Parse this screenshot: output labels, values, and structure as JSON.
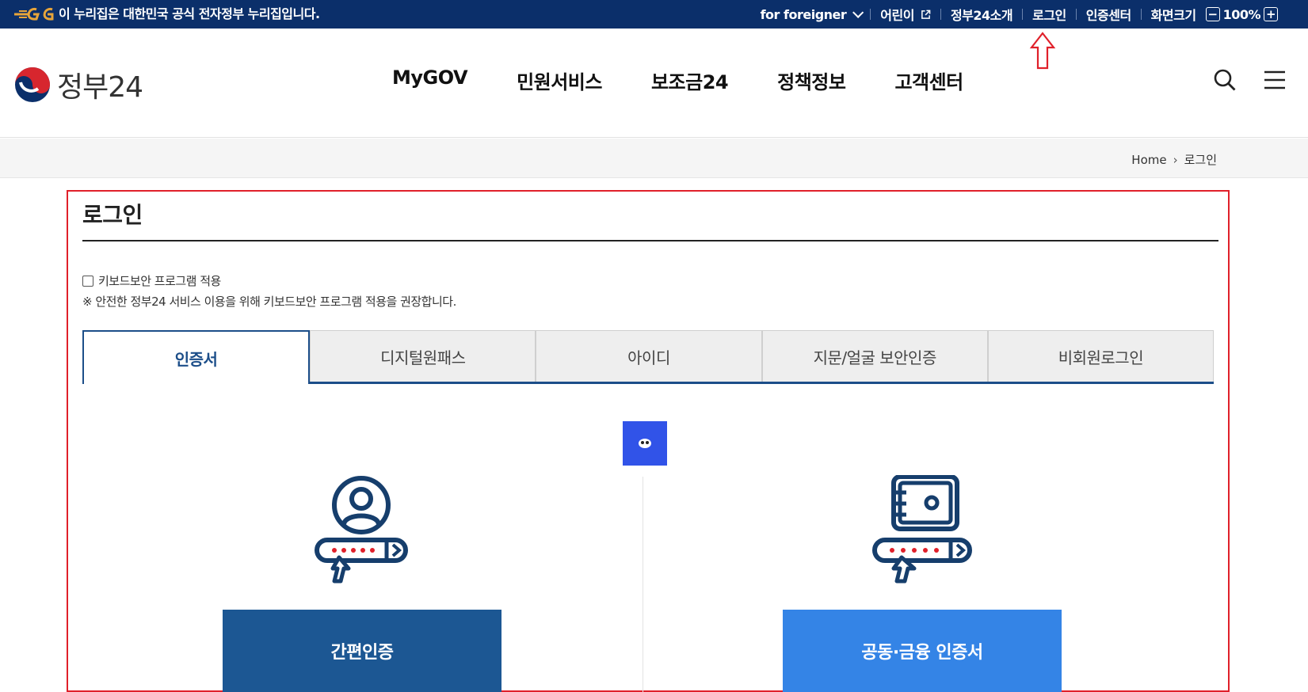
{
  "topbar": {
    "official_notice": "이 누리집은 대한민국 공식 전자정부 누리집입니다.",
    "foreigner": "for foreigner",
    "kids": "어린이",
    "about": "정부24소개",
    "login": "로그인",
    "cert_center": "인증센터",
    "screen_size": "화면크기",
    "zoom": "100%",
    "zoom_minus": "−",
    "zoom_plus": "+"
  },
  "header": {
    "brand": "정부24",
    "nav": [
      "MyGOV",
      "민원서비스",
      "보조금24",
      "정책정보",
      "고객센터"
    ]
  },
  "breadcrumb": {
    "home": "Home",
    "current": "로그인"
  },
  "page": {
    "title": "로그인",
    "keyboard_security_label": "키보드보안 프로그램 적용",
    "keyboard_security_checked": false,
    "keyboard_note": "※ 안전한 정부24 서비스 이용을 위해 키보드보안 프로그램 적용을 권장합니다.",
    "tabs": [
      "인증서",
      "디지털원패스",
      "아이디",
      "지문/얼굴 보안인증",
      "비회원로그인"
    ],
    "active_tab": 0,
    "buttons": {
      "simple_auth": "간편인증",
      "joint_cert": "공동·금융 인증서"
    }
  },
  "colors": {
    "topbar": "#0b2f6a",
    "primary": "#1c4e89",
    "simple_btn": "#1c5793",
    "cert_btn": "#3484e6",
    "highlight": "#e0202a"
  }
}
